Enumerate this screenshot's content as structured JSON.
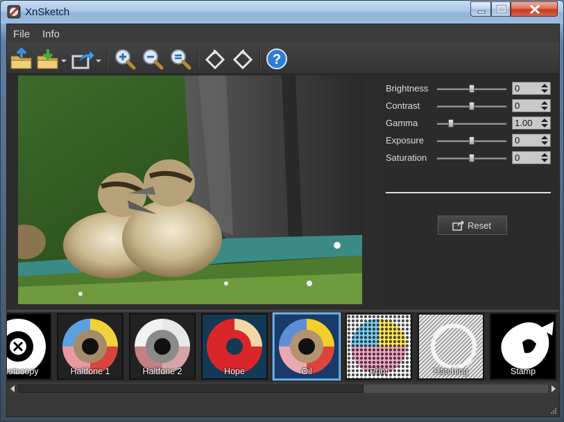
{
  "window": {
    "title": "XnSketch"
  },
  "menu": {
    "items": [
      "File",
      "Info"
    ]
  },
  "toolbar": {
    "icons": [
      "open-folder-icon",
      "save-folder-icon",
      "share-icon",
      "zoom-in-icon",
      "zoom-out-icon",
      "zoom-fit-icon",
      "rotate-left-icon",
      "rotate-right-icon",
      "help-icon"
    ]
  },
  "adjustments": [
    {
      "label": "Brightness",
      "value": "0",
      "level": 0.5
    },
    {
      "label": "Contrast",
      "value": "0",
      "level": 0.5
    },
    {
      "label": "Gamma",
      "value": "1.00",
      "level": 0.2
    },
    {
      "label": "Exposure",
      "value": "0",
      "level": 0.5
    },
    {
      "label": "Saturation",
      "value": "0",
      "level": 0.5
    }
  ],
  "reset": {
    "label": "Reset"
  },
  "filters": [
    {
      "label": "Photocopy",
      "selected": false
    },
    {
      "label": "Haltfone 1",
      "selected": false
    },
    {
      "label": "Haltfone 2",
      "selected": false
    },
    {
      "label": "Hope",
      "selected": false
    },
    {
      "label": "Oil",
      "selected": true
    },
    {
      "label": "Print",
      "selected": false
    },
    {
      "label": "Hatching",
      "selected": false
    },
    {
      "label": "Stamp",
      "selected": false
    }
  ],
  "colors": {
    "selection": "#4ea0e0",
    "panel_bg": "#2b2b2b"
  }
}
